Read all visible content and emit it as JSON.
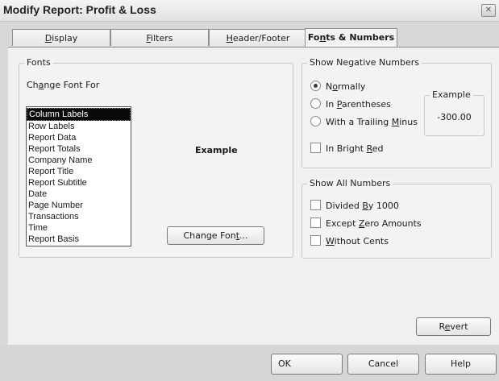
{
  "window": {
    "title": "Modify Report: Profit & Loss",
    "close_glyph": "✕"
  },
  "tabs": [
    {
      "pre": "",
      "key": "D",
      "post": "isplay"
    },
    {
      "pre": "",
      "key": "F",
      "post": "ilters"
    },
    {
      "pre": "",
      "key": "H",
      "post": "eader/Footer"
    },
    {
      "pre": "Fo",
      "key": "n",
      "post": "ts & Numbers"
    }
  ],
  "fonts": {
    "legend": "Fonts",
    "change_font_for": {
      "pre": "Ch",
      "key": "a",
      "post": "nge Font For"
    },
    "items": [
      "Column Labels",
      "Row Labels",
      "Report Data",
      "Report Totals",
      "Company Name",
      "Report Title",
      "Report Subtitle",
      "Date",
      "Page Number",
      "Transactions",
      "Time",
      "Report Basis"
    ],
    "example_label": "Example",
    "change_font_button": {
      "pre": "Change Fon",
      "key": "t",
      "post": "..."
    }
  },
  "negative": {
    "legend": "Show Negative Numbers",
    "normally": {
      "pre": "N",
      "key": "o",
      "post": "rmally"
    },
    "parentheses": {
      "pre": "In ",
      "key": "P",
      "post": "arentheses"
    },
    "trailing_minus": {
      "pre": "With a Trailing ",
      "key": "M",
      "post": "inus"
    },
    "example_legend": "Example",
    "example_value": "-300.00",
    "bright_red": {
      "pre": "In Bright ",
      "key": "R",
      "post": "ed"
    }
  },
  "all_numbers": {
    "legend": "Show All Numbers",
    "divided": {
      "pre": "Divided ",
      "key": "B",
      "post": "y 1000"
    },
    "except_zero": {
      "pre": "Except ",
      "key": "Z",
      "post": "ero Amounts"
    },
    "without_cents": {
      "pre": "",
      "key": "W",
      "post": "ithout Cents"
    }
  },
  "revert_button": {
    "pre": "R",
    "key": "e",
    "post": "vert"
  },
  "footer": {
    "ok": "OK",
    "cancel": "Cancel",
    "help": "Help"
  }
}
